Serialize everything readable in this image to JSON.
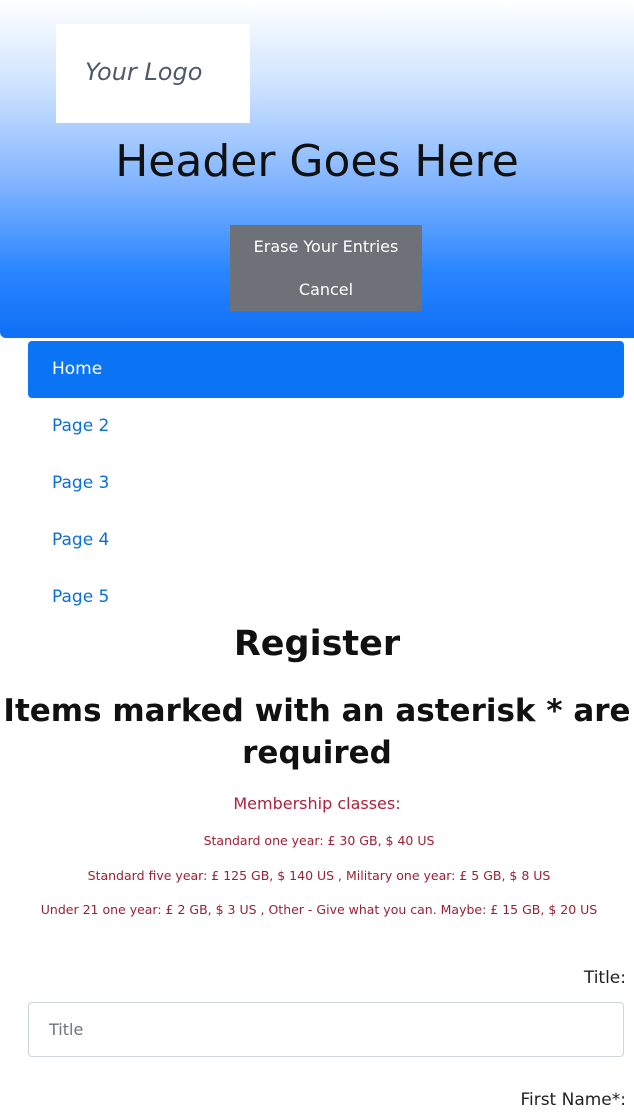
{
  "header": {
    "logo_text": "Your Logo",
    "title": "Header Goes Here",
    "buttons": {
      "erase_label": "Erase Your Entries",
      "cancel_label": "Cancel"
    }
  },
  "nav": {
    "items": [
      {
        "label": "Home",
        "active": true
      },
      {
        "label": "Page 2",
        "active": false
      },
      {
        "label": "Page 3",
        "active": false
      },
      {
        "label": "Page 4",
        "active": false
      },
      {
        "label": "Page 5",
        "active": false
      }
    ]
  },
  "content": {
    "register_title": "Register",
    "required_note": "Items marked with an asterisk * are required",
    "membership": {
      "heading": "Membership classes:",
      "lines": [
        "Standard one year: £ 30 GB, $ 40 US",
        "Standard five year: £ 125 GB, $ 140 US , Military one year: £ 5 GB, $ 8 US",
        "Under 21 one year: £ 2 GB, $ 3 US , Other - Give what you can. Maybe: £ 15 GB, $ 20 US"
      ]
    },
    "form": {
      "title_label": "Title:",
      "title_placeholder": "Title",
      "first_name_label": "First Name*:"
    }
  },
  "colors": {
    "header_gradient_bottom": "#0f6ff5",
    "button_group_bg": "#6e7177",
    "nav_active_bg": "#0a74f5",
    "nav_link": "#0a6fd6",
    "membership_text": "#9c1f35"
  }
}
